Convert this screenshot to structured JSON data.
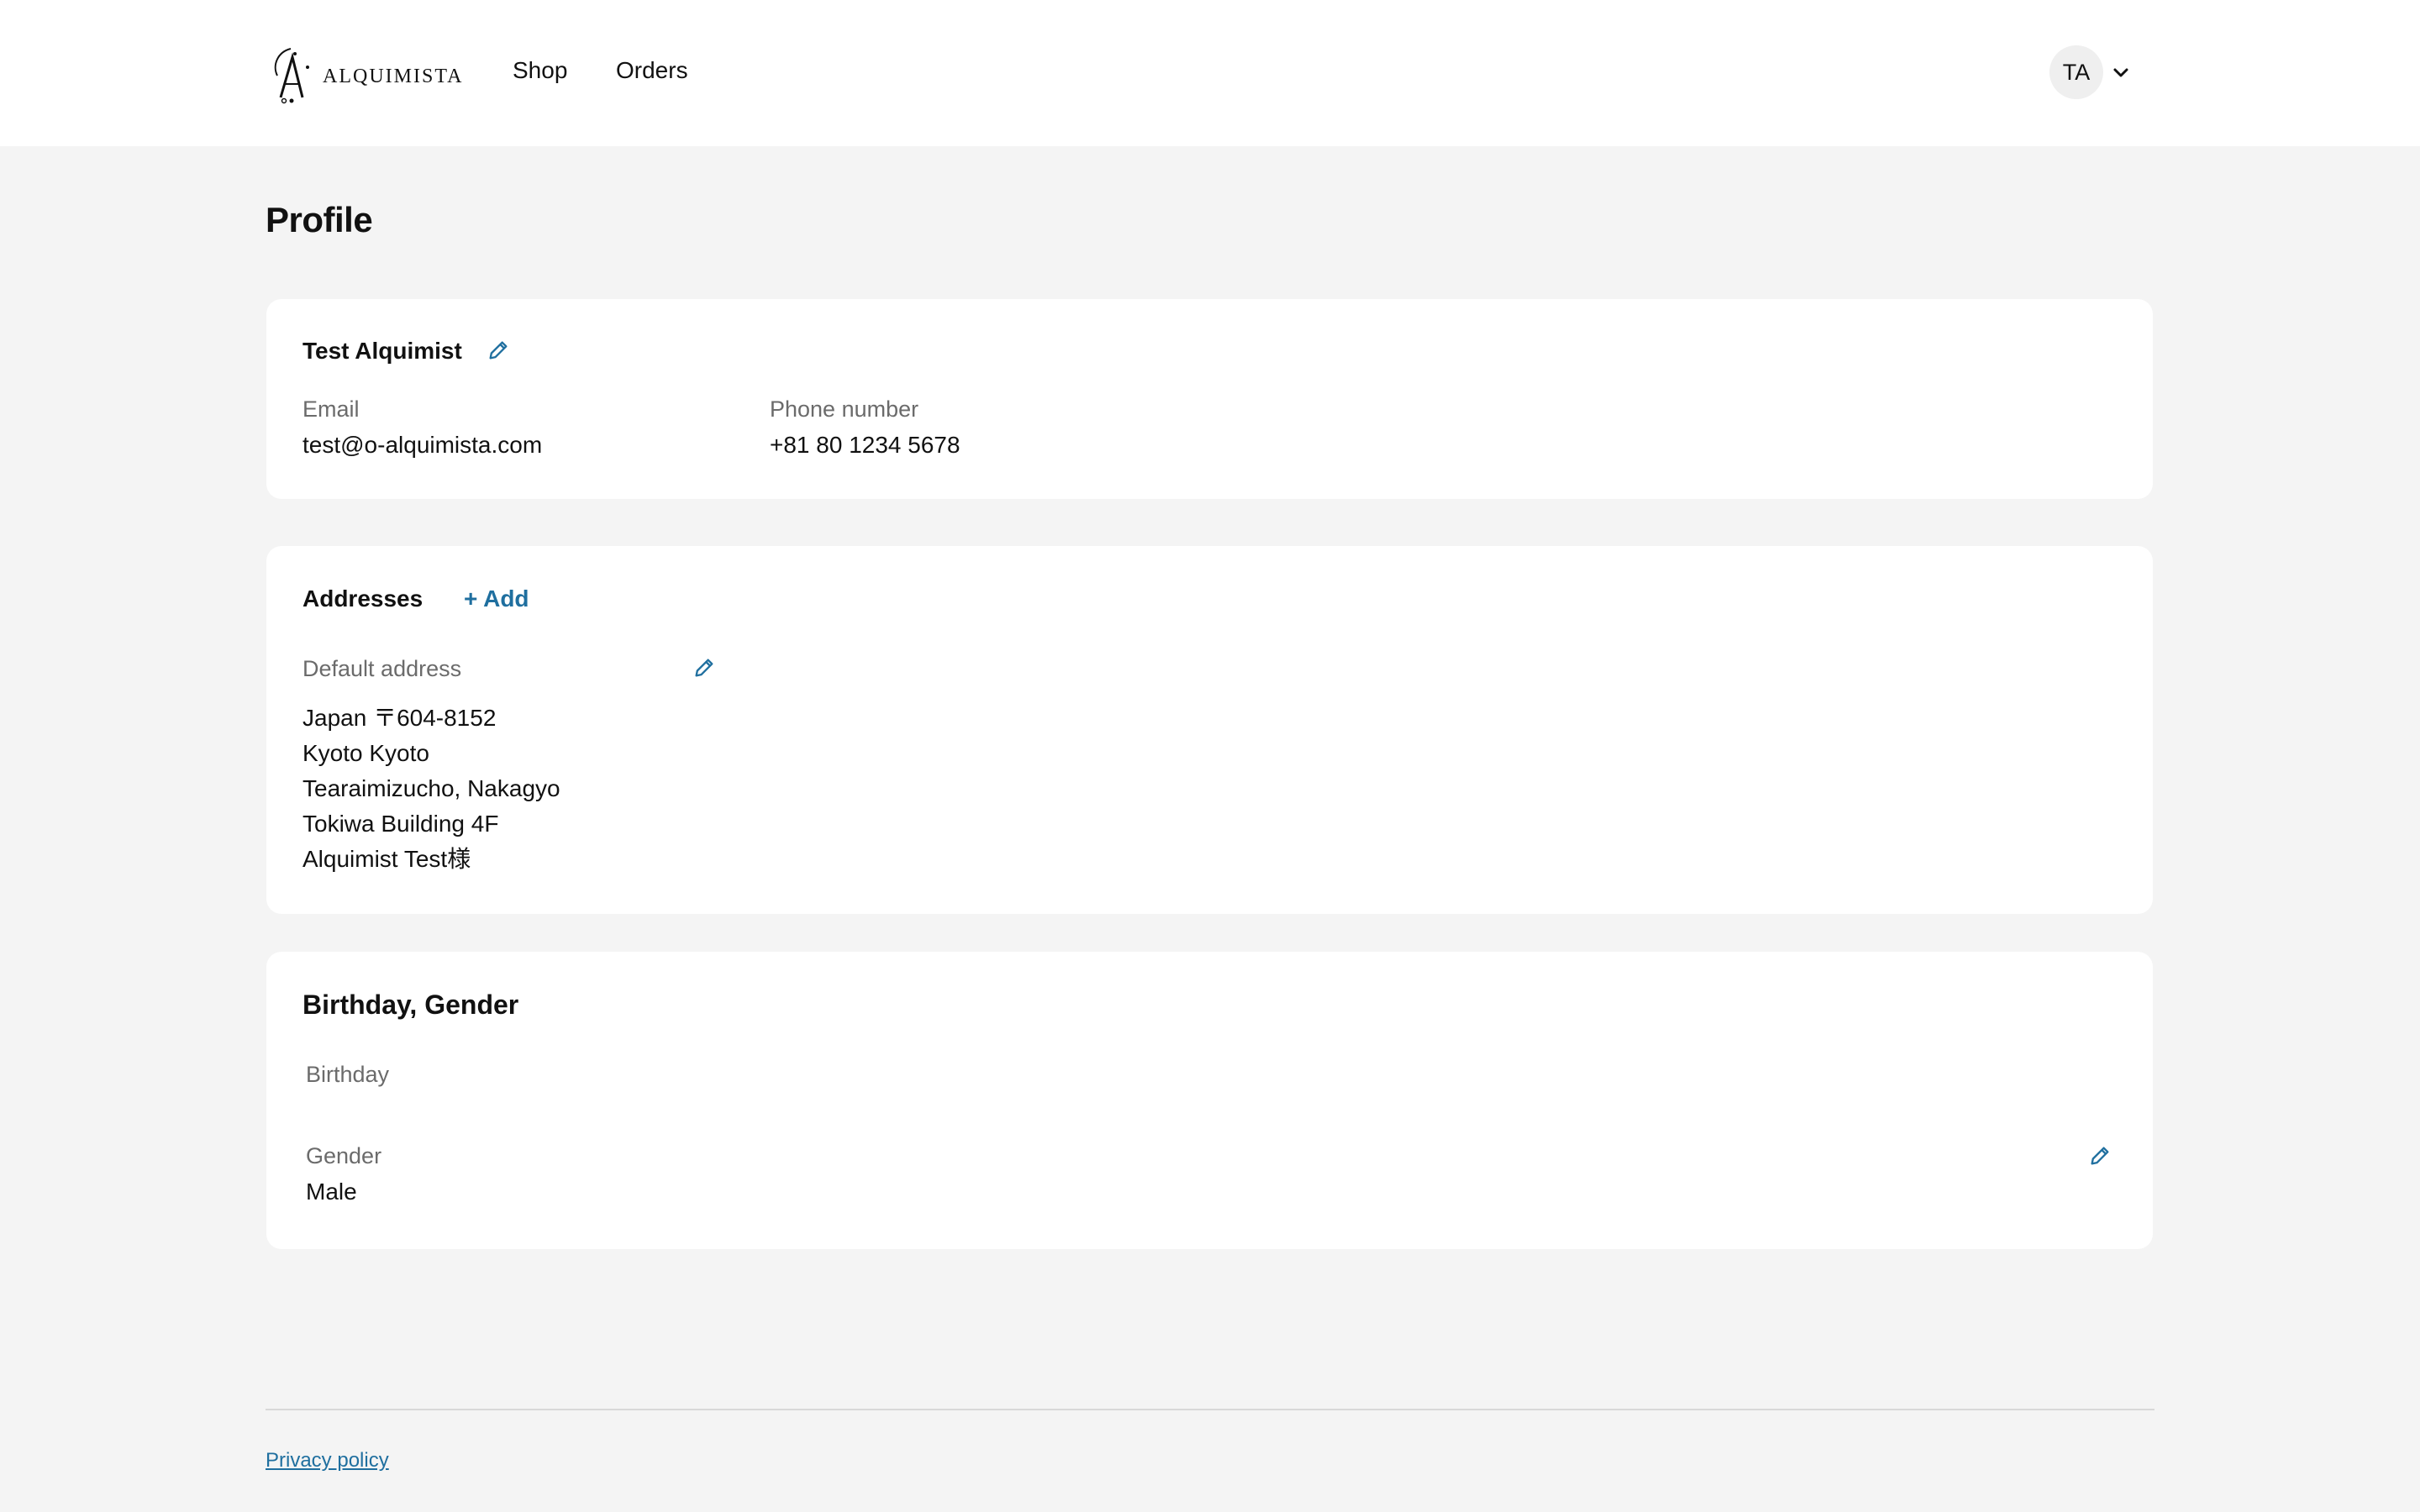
{
  "brand": {
    "name": "ALQUIMISTA"
  },
  "nav": {
    "shop": "Shop",
    "orders": "Orders"
  },
  "user": {
    "initials": "TA"
  },
  "page": {
    "title": "Profile"
  },
  "profile": {
    "name": "Test Alquimist",
    "email_label": "Email",
    "email": "test@o-alquimista.com",
    "phone_label": "Phone number",
    "phone": "+81 80 1234 5678"
  },
  "addresses": {
    "title": "Addresses",
    "add_label": "+ Add",
    "default_label": "Default address",
    "lines": [
      "Japan 〒604-8152",
      "Kyoto Kyoto",
      "Tearaimizucho, Nakagyo",
      "Tokiwa Building 4F",
      "Alquimist Test様"
    ]
  },
  "birthday_gender": {
    "title": "Birthday, Gender",
    "birthday_label": "Birthday",
    "birthday": "",
    "gender_label": "Gender",
    "gender": "Male"
  },
  "footer": {
    "privacy": "Privacy policy"
  },
  "colors": {
    "accent": "#1f6f9f",
    "background": "#f4f4f4",
    "card": "#ffffff"
  },
  "icons": {
    "edit": "pencil-icon",
    "account_menu": "chevron-down-icon",
    "logo": "alquimista-logo"
  }
}
